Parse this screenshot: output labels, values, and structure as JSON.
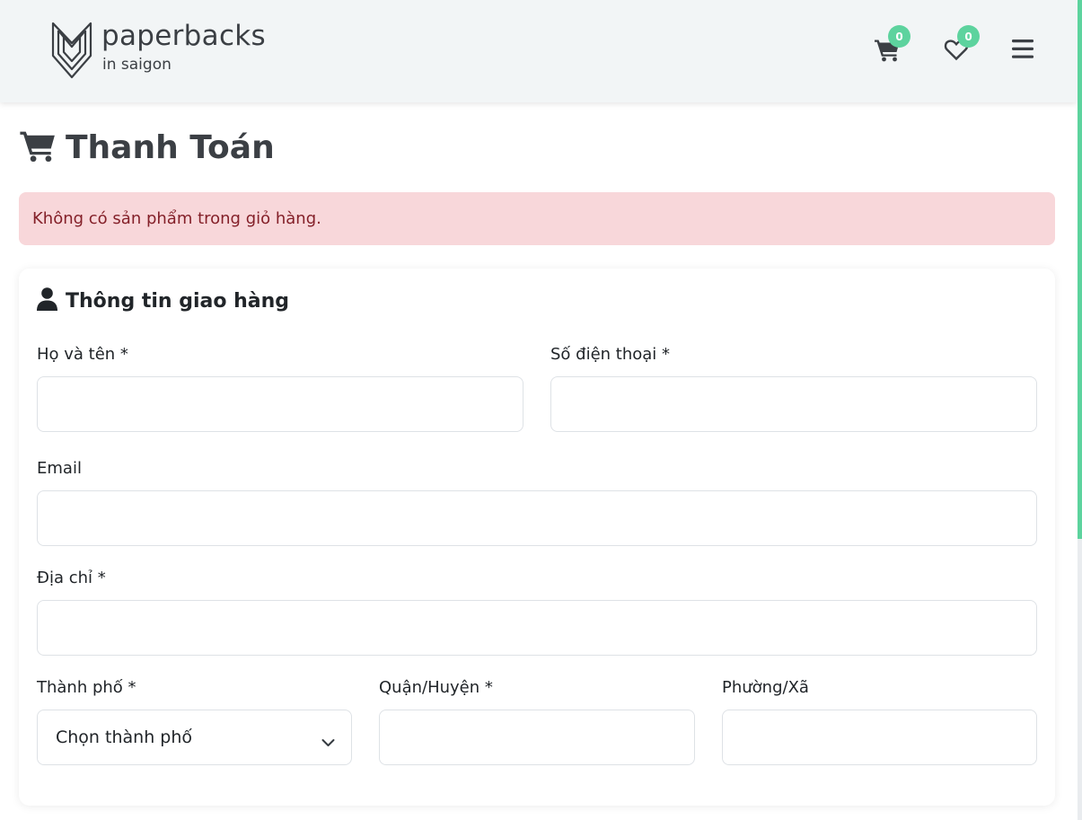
{
  "header": {
    "brand_name": "paperbacks",
    "brand_sub": "in saigon",
    "cart_count": "0",
    "wishlist_count": "0",
    "icons": [
      "logo-chevron-icon",
      "cart-icon",
      "heart-icon",
      "menu-icon"
    ]
  },
  "page": {
    "title": "Thanh Toán",
    "alert": "Không có sản phẩm trong giỏ hàng."
  },
  "shipping": {
    "title": "Thông tin giao hàng",
    "fields": {
      "fullname": {
        "label": "Họ và tên *",
        "value": ""
      },
      "phone": {
        "label": "Số điện thoại *",
        "value": ""
      },
      "email": {
        "label": "Email",
        "value": ""
      },
      "address": {
        "label": "Địa chỉ *",
        "value": ""
      },
      "city": {
        "label": "Thành phố *",
        "selected": "Chọn thành phố"
      },
      "district": {
        "label": "Quận/Huyện *",
        "value": ""
      },
      "ward": {
        "label": "Phường/Xã",
        "value": ""
      }
    }
  },
  "colors": {
    "header_bg": "#f2f5f6",
    "badge": "#5dd39e",
    "alert_bg": "#f8d7da",
    "alert_text": "#842029",
    "title_text": "#3b3f44"
  }
}
